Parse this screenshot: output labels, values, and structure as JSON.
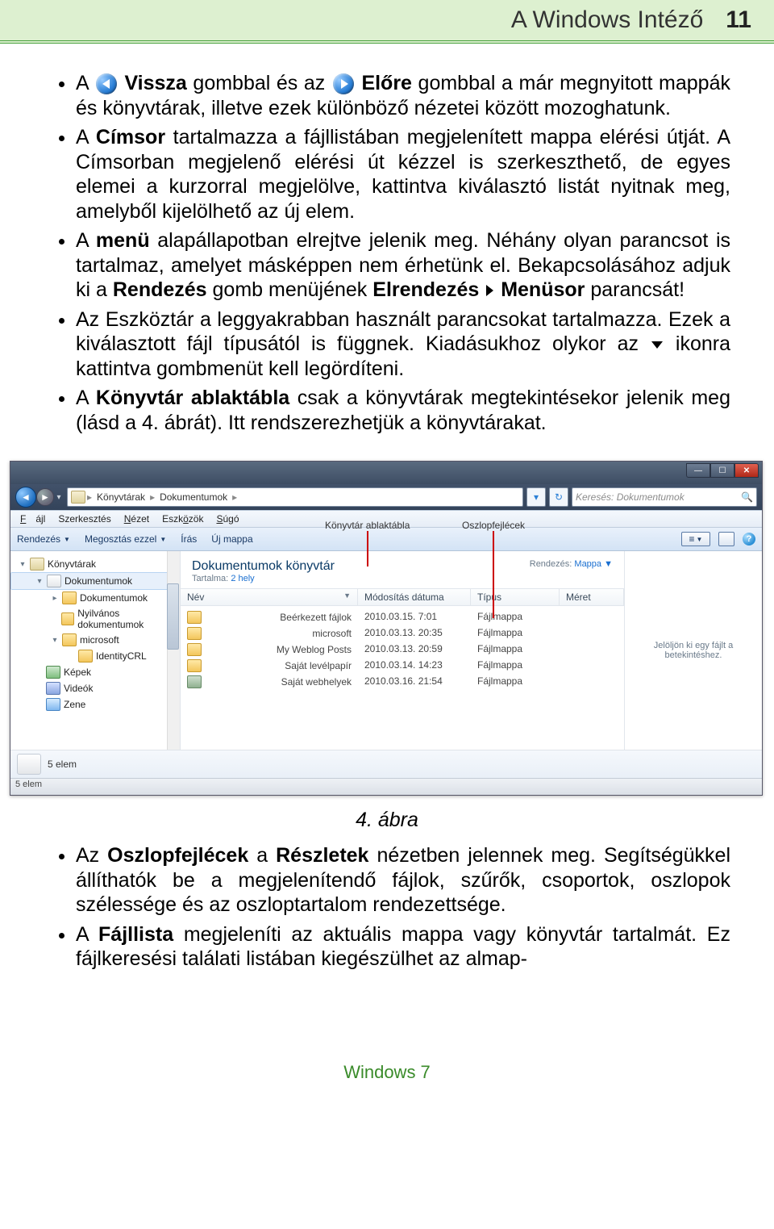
{
  "header": {
    "title": "A Windows Intéző",
    "page_number": "11"
  },
  "bullets": {
    "b1_a": "A",
    "b1_back": "Vissza",
    "b1_mid": " gombbal és az ",
    "b1_fwd": "Előre",
    "b1_rest": " gombbal a már megnyitott mappák és könyvtárak, illetve ezek különböző nézetei között mozoghatunk.",
    "b2_a": "A ",
    "b2_bold1": "Címsor",
    "b2_rest": " tartalmazza a fájllistában megjelenített mappa elérési útját. A Címsorban megjelenő elérési út kézzel is szerkeszthető, de egyes elemei a kurzorral megjelölve, kattintva kiválasztó listát nyitnak meg, amelyből kijelölhető az új elem.",
    "b3_a": "A ",
    "b3_bold1": "menü",
    "b3_mid1": " alapállapotban elrejtve jelenik meg. Néhány olyan parancsot is tartalmaz, amelyet másképpen nem érhetünk el. Bekapcsolásához adjuk ki a ",
    "b3_bold2": "Rendezés",
    "b3_mid2": " gomb menüjének ",
    "b3_bold3": "Elrendezés",
    "b3_bold4": "Menüsor",
    "b3_tail": " parancsát!",
    "b4_text": "Az Eszköztár a leggyakrabban használt parancsokat tartalmazza. Ezek a kiválasztott fájl típusától is függnek. Kiadásukhoz olykor az ",
    "b4_tail": " ikonra kattintva gombmenüt kell legördíteni.",
    "b5_a": "A ",
    "b5_bold1": "Könyvtár ablaktábla",
    "b5_rest": " csak a könyvtárak megtekintésekor jelenik meg (lásd a 4. ábrát). Itt rendszerezhetjük a könyvtárakat."
  },
  "screenshot": {
    "annot_lib": "Könyvtár ablaktábla",
    "annot_col": "Oszlopfejlécek",
    "breadcrumb": [
      "Könyvtárak",
      "Dokumentumok"
    ],
    "search_placeholder": "Keresés: Dokumentumok",
    "menubar": [
      "Fájl",
      "Szerkesztés",
      "Nézet",
      "Eszközök",
      "Súgó"
    ],
    "toolbar": {
      "organize": "Rendezés",
      "share": "Megosztás ezzel",
      "write": "Írás",
      "newfolder": "Új mappa"
    },
    "navpane": [
      {
        "lvl": 0,
        "icon": "lib",
        "fold": "▾",
        "label": "Könyvtárak",
        "sel": false
      },
      {
        "lvl": 1,
        "icon": "doc",
        "fold": "▾",
        "label": "Dokumentumok",
        "sel": true
      },
      {
        "lvl": 2,
        "icon": "fold",
        "fold": "▸",
        "label": "Dokumentumok",
        "sel": false
      },
      {
        "lvl": 2,
        "icon": "fold",
        "fold": "",
        "label": "Nyilvános dokumentumok",
        "sel": false
      },
      {
        "lvl": 2,
        "icon": "fold",
        "fold": "▾",
        "label": "microsoft",
        "sel": false
      },
      {
        "lvl": 3,
        "icon": "fold",
        "fold": "",
        "label": "IdentityCRL",
        "sel": false
      },
      {
        "lvl": 1,
        "icon": "pic",
        "fold": "",
        "label": "Képek",
        "sel": false
      },
      {
        "lvl": 1,
        "icon": "vid",
        "fold": "",
        "label": "Videók",
        "sel": false
      },
      {
        "lvl": 1,
        "icon": "mus",
        "fold": "",
        "label": "Zene",
        "sel": false
      }
    ],
    "lib_header": {
      "title": "Dokumentumok könyvtár",
      "subtitle_label": "Tartalma:",
      "subtitle_link": "2 hely",
      "sort_label": "Rendezés:",
      "sort_value": "Mappa"
    },
    "columns": {
      "name": "Név",
      "date": "Módosítás dátuma",
      "type": "Típus",
      "size": "Méret"
    },
    "rows": [
      {
        "icon": "fold",
        "name": "Beérkezett fájlok",
        "date": "2010.03.15. 7:01",
        "type": "Fájlmappa",
        "size": ""
      },
      {
        "icon": "fold",
        "name": "microsoft",
        "date": "2010.03.13. 20:35",
        "type": "Fájlmappa",
        "size": ""
      },
      {
        "icon": "fold",
        "name": "My Weblog Posts",
        "date": "2010.03.13. 20:59",
        "type": "Fájlmappa",
        "size": ""
      },
      {
        "icon": "fold",
        "name": "Saját levélpapír",
        "date": "2010.03.14. 14:23",
        "type": "Fájlmappa",
        "size": ""
      },
      {
        "icon": "web",
        "name": "Saját webhelyek",
        "date": "2010.03.16. 21:54",
        "type": "Fájlmappa",
        "size": ""
      }
    ],
    "preview_hint": "Jelöljön ki egy fájlt a betekintéshez.",
    "status_strip": "5 elem",
    "status_bar": "5 elem"
  },
  "fig_caption": "4. ábra",
  "bullets2": {
    "b1_a": "Az ",
    "b1_bold1": "Oszlopfejlécek",
    "b1_mid": " a ",
    "b1_bold2": "Részletek",
    "b1_rest": " nézetben jelennek meg. Segítségükkel állíthatók be a megjelenítendő fájlok, szűrők, csoportok, oszlopok szélessége és az oszloptartalom rendezettsége.",
    "b2_a": "A ",
    "b2_bold1": "Fájllista",
    "b2_rest": " megjeleníti az aktuális mappa vagy könyvtár tartalmát. Ez fájlkeresési találati listában kiegészülhet az almap-"
  },
  "footer": "Windows 7"
}
